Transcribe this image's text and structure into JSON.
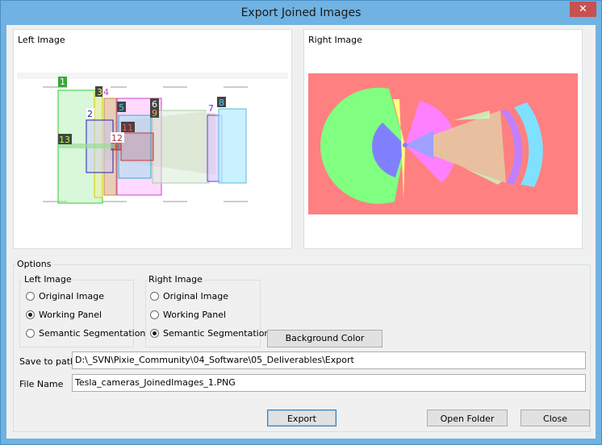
{
  "window": {
    "title": "Export Joined Images",
    "close_icon": "close-icon"
  },
  "left_panel": {
    "label": "Left Image",
    "boxes": [
      {
        "id": "1",
        "color": "#33cc33"
      },
      {
        "id": "2",
        "color": "#2222aa"
      },
      {
        "id": "3",
        "color": "#cccc00"
      },
      {
        "id": "4",
        "color": "#cc44cc"
      },
      {
        "id": "5",
        "color": "#33aacc"
      },
      {
        "id": "6",
        "color": "#aaccaa"
      },
      {
        "id": "7",
        "color": "#7733cc"
      },
      {
        "id": "8",
        "color": "#55bbdd"
      },
      {
        "id": "9",
        "color": "#cc8844"
      },
      {
        "id": "11",
        "color": "#cc3333"
      },
      {
        "id": "12",
        "color": "#aa3333"
      },
      {
        "id": "13",
        "color": "#77cc33"
      }
    ]
  },
  "right_panel": {
    "label": "Right Image",
    "background": "#ff8080"
  },
  "options": {
    "label": "Options",
    "left_group": {
      "label": "Left Image",
      "choices": [
        "Original Image",
        "Working Panel",
        "Semantic Segmentation"
      ],
      "selected": "Working Panel"
    },
    "right_group": {
      "label": "Right Image",
      "choices": [
        "Original Image",
        "Working Panel",
        "Semantic Segmentation"
      ],
      "selected": "Semantic Segmentation"
    },
    "background_color_label": "Background Color",
    "save_to_path_label": "Save to path",
    "save_to_path_value": "D:\\_SVN\\Pixie_Community\\04_Software\\05_Deliverables\\Export",
    "file_name_label": "File Name",
    "file_name_value": "Tesla_cameras_JoinedImages_1.PNG"
  },
  "buttons": {
    "export": "Export",
    "open_folder": "Open Folder",
    "close": "Close"
  }
}
